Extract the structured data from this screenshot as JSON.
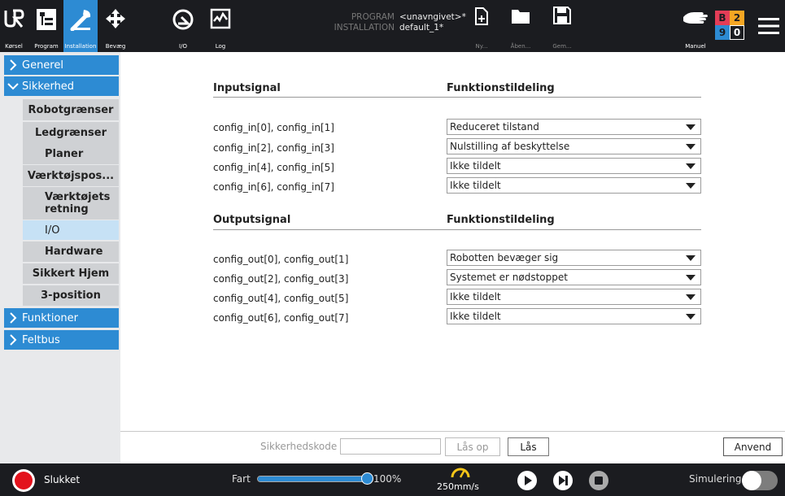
{
  "topbar": {
    "nav": [
      {
        "label": "Kørsel"
      },
      {
        "label": "Program"
      },
      {
        "label": "Installation"
      },
      {
        "label": "Bevæg"
      },
      {
        "label": "I/O"
      },
      {
        "label": "Log"
      }
    ],
    "program_key": "PROGRAM",
    "program_val": "<unavngivet>*",
    "installation_key": "INSTALLATION",
    "installation_val": "default_1*",
    "file_new": "Ny...",
    "file_open": "Åben...",
    "file_save": "Gem...",
    "mode_label": "Manuel",
    "badge": [
      "B",
      "2",
      "9",
      "0"
    ]
  },
  "sidebar": {
    "generel": "Generel",
    "sikkerhed": "Sikkerhed",
    "items": [
      "Robotgrænser",
      "Ledgrænser",
      "Planer",
      "Værktøjspos...",
      "Værktøjets retning",
      "I/O",
      "Hardware",
      "Sikkert Hjem",
      "3-position"
    ],
    "funktioner": "Funktioner",
    "feltbus": "Feltbus"
  },
  "main": {
    "input_header": "Inputsignal",
    "func_header_1": "Funktionstildeling",
    "inputs": [
      {
        "signal": "config_in[0], config_in[1]",
        "value": "Reduceret tilstand"
      },
      {
        "signal": "config_in[2], config_in[3]",
        "value": "Nulstilling af beskyttelse"
      },
      {
        "signal": "config_in[4], config_in[5]",
        "value": "Ikke tildelt"
      },
      {
        "signal": "config_in[6], config_in[7]",
        "value": "Ikke tildelt"
      }
    ],
    "output_header": "Outputsignal",
    "func_header_2": "Funktionstildeling",
    "outputs": [
      {
        "signal": "config_out[0], config_out[1]",
        "value": "Robotten bevæger sig"
      },
      {
        "signal": "config_out[2], config_out[3]",
        "value": "Systemet er nødstoppet"
      },
      {
        "signal": "config_out[4], config_out[5]",
        "value": "Ikke tildelt"
      },
      {
        "signal": "config_out[6], config_out[7]",
        "value": "Ikke tildelt"
      }
    ]
  },
  "lockbar": {
    "code_placeholder": "Sikkerhedskode",
    "unlock": "Lås op",
    "lock": "Lås",
    "apply": "Anvend"
  },
  "bottombar": {
    "status": "Slukket",
    "speed_label": "Fart",
    "speed_fraction": 1.0,
    "speed_value": "100%",
    "tcp_speed": "250mm/s",
    "simulation_label": "Simulering"
  },
  "colors": {
    "accent": "#2d8bd3",
    "power_red": "#e3121c",
    "bar": "#1b1c20"
  }
}
